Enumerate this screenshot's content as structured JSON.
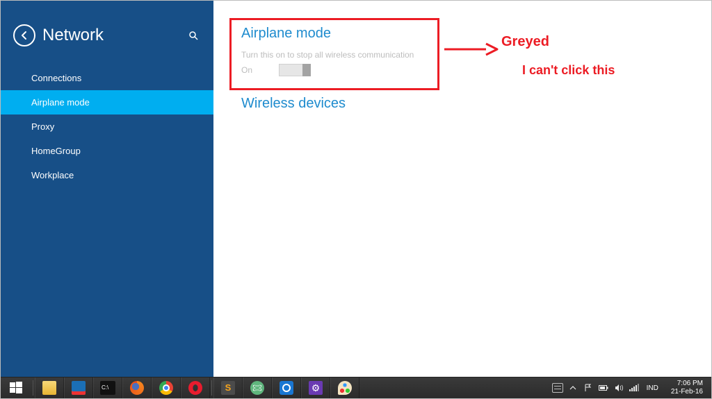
{
  "sidebar": {
    "title": "Network",
    "items": [
      {
        "label": "Connections"
      },
      {
        "label": "Airplane mode"
      },
      {
        "label": "Proxy"
      },
      {
        "label": "HomeGroup"
      },
      {
        "label": "Workplace"
      }
    ],
    "selected_index": 1
  },
  "content": {
    "section1_title": "Airplane mode",
    "section1_desc": "Turn this on to stop all wireless communication",
    "toggle_label": "On",
    "section2_title": "Wireless devices"
  },
  "annotation": {
    "label1": "Greyed",
    "label2": "I can't click this"
  },
  "taskbar": {
    "ime": "IND",
    "time": "7:06 PM",
    "date": "21-Feb-16"
  }
}
